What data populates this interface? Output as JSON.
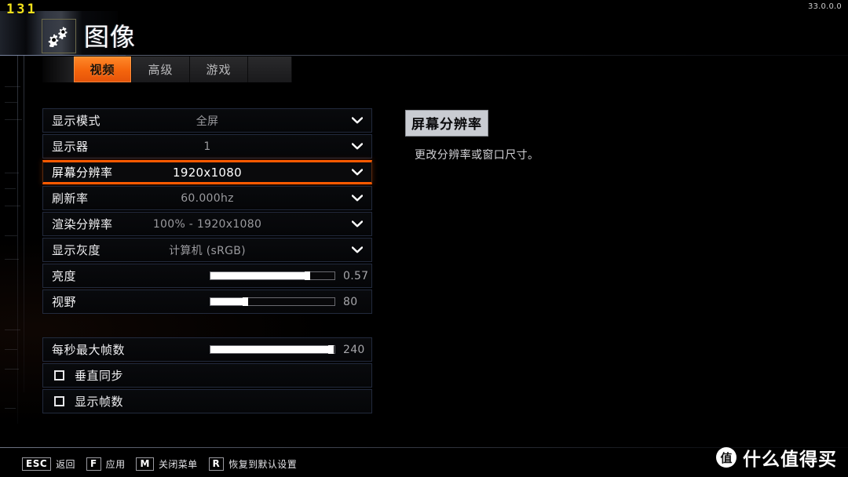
{
  "hud": {
    "fps": "131",
    "version": "33.0.0.0"
  },
  "header": {
    "icon": "gears-icon",
    "title": "图像"
  },
  "tabs": [
    {
      "label": "视频",
      "active": true
    },
    {
      "label": "高级",
      "active": false
    },
    {
      "label": "游戏",
      "active": false
    },
    {
      "label": "",
      "active": false
    }
  ],
  "settings": {
    "group_one": [
      {
        "type": "dropdown",
        "name": "display-mode",
        "label": "显示模式",
        "value": "全屏",
        "selected": false
      },
      {
        "type": "dropdown",
        "name": "monitor",
        "label": "显示器",
        "value": "1",
        "selected": false
      },
      {
        "type": "dropdown",
        "name": "screen-resolution",
        "label": "屏幕分辨率",
        "value": "1920x1080",
        "selected": true
      },
      {
        "type": "dropdown",
        "name": "refresh-rate",
        "label": "刷新率",
        "value": "60.000hz",
        "selected": false
      },
      {
        "type": "dropdown",
        "name": "render-resolution",
        "label": "渲染分辨率",
        "value": "100% - 1920x1080",
        "selected": false
      },
      {
        "type": "dropdown",
        "name": "display-gamma",
        "label": "显示灰度",
        "value": "计算机 (sRGB)",
        "selected": false
      },
      {
        "type": "slider",
        "name": "brightness",
        "label": "亮度",
        "value": "0.57",
        "percent": 78,
        "selected": false
      },
      {
        "type": "slider",
        "name": "field-of-view",
        "label": "视野",
        "value": "80",
        "percent": 28,
        "selected": false
      }
    ],
    "group_two": [
      {
        "type": "slider",
        "name": "max-fps",
        "label": "每秒最大帧数",
        "value": "240",
        "percent": 97,
        "selected": false
      },
      {
        "type": "checkbox",
        "name": "vsync",
        "label": "垂直同步",
        "checked": false,
        "selected": false
      },
      {
        "type": "checkbox",
        "name": "show-fps",
        "label": "显示帧数",
        "checked": false,
        "selected": false
      }
    ]
  },
  "info": {
    "title": "屏幕分辨率",
    "description": "更改分辨率或窗口尺寸。"
  },
  "footer": [
    {
      "key": "ESC",
      "label": "返回"
    },
    {
      "key": "F",
      "label": "应用"
    },
    {
      "key": "M",
      "label": "关闭菜单"
    },
    {
      "key": "R",
      "label": "恢复到默认设置"
    }
  ],
  "watermark": {
    "logo": "值",
    "text": "什么值得买"
  },
  "colors": {
    "accent_orange": "#ff5a00",
    "tab_active": "#f4640c",
    "fps_yellow": "#f2e11c",
    "row_border": "#222a3d",
    "info_title_bg": "#c9ccd2"
  }
}
